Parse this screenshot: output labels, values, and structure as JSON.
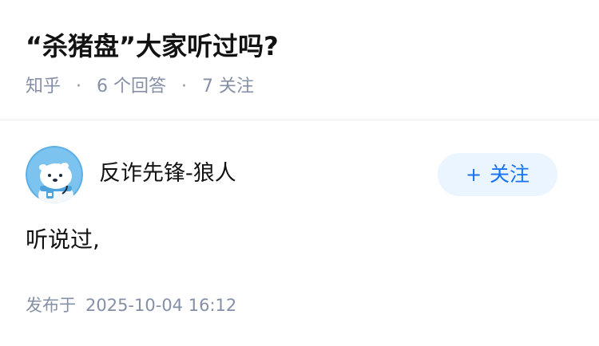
{
  "question": {
    "title": "“杀猪盘”大家听过吗?",
    "source": "知乎",
    "answer_count": "6",
    "answer_label": "个回答",
    "follower_count": "7",
    "follower_label": "关注",
    "separator": "·"
  },
  "answer": {
    "author_name": "反诈先锋-狼人",
    "avatar_icon": "polar-bear-avatar",
    "follow_button": {
      "plus": "+",
      "label": "关注"
    },
    "content": "听说过,",
    "publish_label": "发布于",
    "publish_date": "2025-10-04 16:12"
  },
  "colors": {
    "title": "#121212",
    "meta": "#8590a6",
    "accent": "#1772f6",
    "button_bg": "#ebf5ff"
  }
}
